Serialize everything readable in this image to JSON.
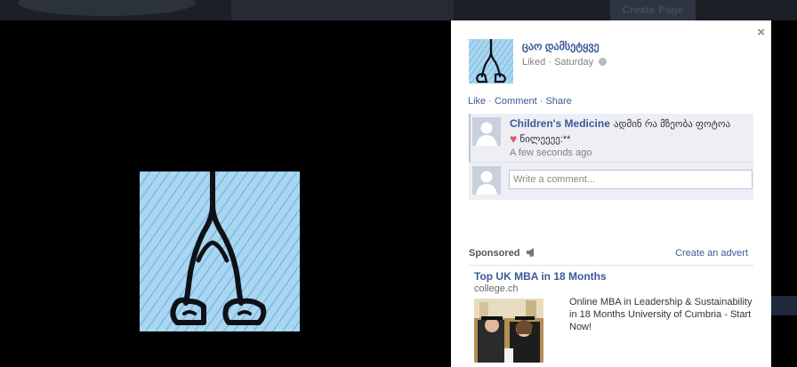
{
  "background": {
    "create_page_label": "Create Page"
  },
  "post": {
    "owner_name": "ცაო დამსეტყვე",
    "status_word": "Liked",
    "status_dot": "·",
    "status_time": "Saturday",
    "close_glyph": "×",
    "actions": {
      "like": "Like",
      "comment": "Comment",
      "share": "Share",
      "sep": "·"
    }
  },
  "comments": [
    {
      "author": "Children's Medicine",
      "text_before": "ადმინ რა მზეობა ფოტოა",
      "text_after": "წილეეეე:**",
      "heart_glyph": "♥",
      "time": "A few seconds ago"
    }
  ],
  "comment_input": {
    "placeholder": "Write a comment..."
  },
  "sponsored": {
    "title": "Sponsored",
    "create_link": "Create an advert",
    "ad": {
      "title": "Top UK MBA in 18 Months",
      "url": "college.ch",
      "text": "Online MBA in Leadership & Sustainability in 18 Months University of Cumbria - Start Now!"
    }
  },
  "colors": {
    "link": "#3b5998",
    "comment_bg": "#edeff4",
    "photo_blue": "#9fd0ef",
    "icon_dark": "#0e1117"
  },
  "icons": [
    "close-icon",
    "globe-icon",
    "megaphone-icon",
    "heart-icon"
  ]
}
